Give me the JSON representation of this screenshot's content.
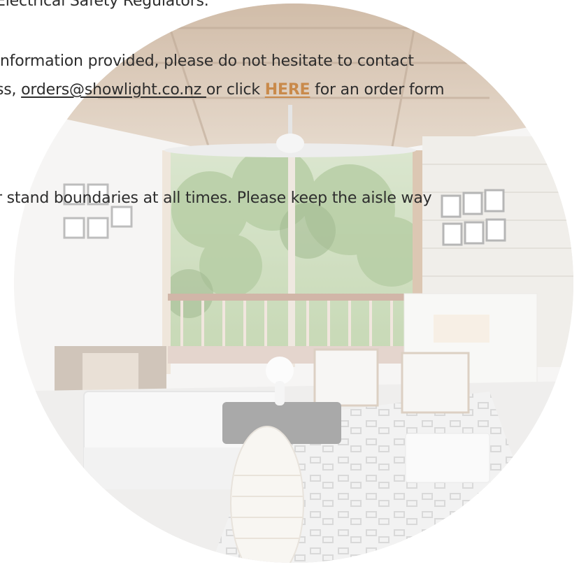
{
  "notice": {
    "line1": "Electrical Safety Regulators.",
    "line2": "information provided, please do not hesitate to contact",
    "line3_prefix": "ss, ",
    "email": "orders@showlight.co.nz ",
    "line3_middle": "or click ",
    "here_link": "HERE",
    "line3_suffix": " for an order form",
    "line4": "r stand boundaries at all times. Please keep the aisle way"
  },
  "colors": {
    "link_accent": "#c98a4b",
    "text": "#2d2d2d"
  },
  "image": {
    "subject": "faded circular interior room illustration",
    "icon": "room-photo"
  }
}
